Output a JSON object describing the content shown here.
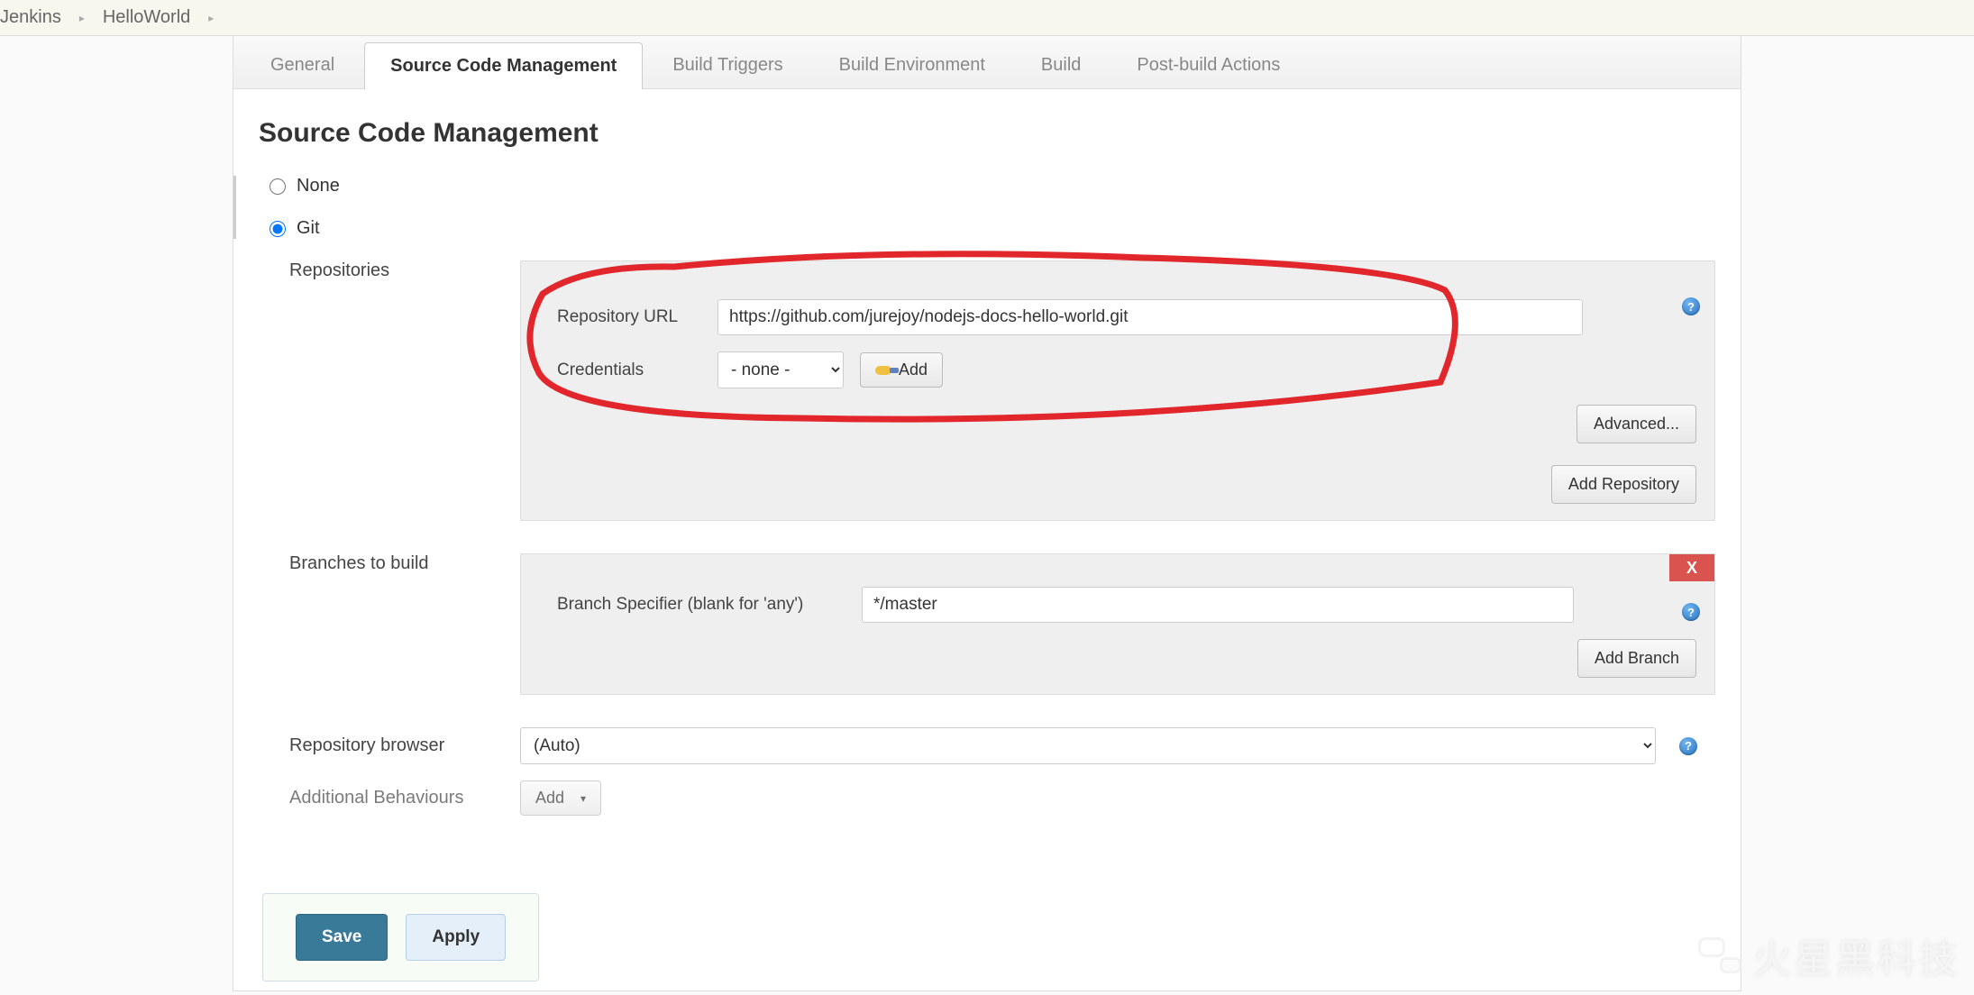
{
  "breadcrumb": {
    "root": "Jenkins",
    "project": "HelloWorld"
  },
  "tabs": {
    "general": "General",
    "scm": "Source Code Management",
    "triggers": "Build Triggers",
    "env": "Build Environment",
    "build": "Build",
    "post": "Post-build Actions"
  },
  "section_title": "Source Code Management",
  "scm": {
    "none_label": "None",
    "git_label": "Git",
    "selected": "git",
    "repositories_label": "Repositories",
    "repo_url_label": "Repository URL",
    "repo_url_value": "https://github.com/jurejoy/nodejs-docs-hello-world.git",
    "credentials_label": "Credentials",
    "credentials_value": "- none -",
    "add_cred_label": "Add",
    "advanced_label": "Advanced...",
    "add_repo_label": "Add Repository",
    "branches_label": "Branches to build",
    "branch_spec_label": "Branch Specifier (blank for 'any')",
    "branch_spec_value": "*/master",
    "add_branch_label": "Add Branch",
    "delete_label": "X",
    "browser_label": "Repository browser",
    "browser_value": "(Auto)",
    "addl_behaviours_label": "Additional Behaviours",
    "add_behaviour_label": "Add"
  },
  "footer": {
    "save": "Save",
    "apply": "Apply"
  },
  "watermark": "火星黑科技"
}
